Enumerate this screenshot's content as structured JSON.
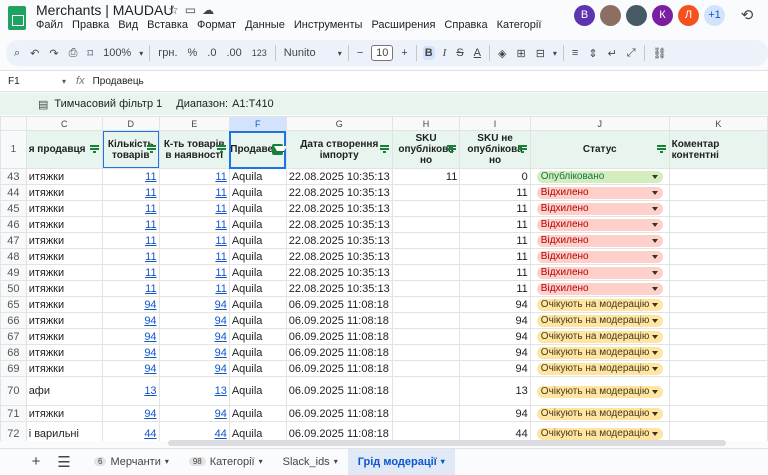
{
  "app": {
    "title": "Merchants | MAUDAU",
    "menu": [
      "Файл",
      "Правка",
      "Вид",
      "Вставка",
      "Формат",
      "Данные",
      "Инструменты",
      "Расширения",
      "Справка",
      "Категорії"
    ],
    "avatars": [
      {
        "letter": "В",
        "color": "#5e35b1"
      },
      {
        "letter": "",
        "color": "#8d6e63"
      },
      {
        "letter": "",
        "color": "#455a64"
      },
      {
        "letter": "К",
        "color": "#7b1fa2"
      },
      {
        "letter": "Л",
        "color": "#f4511e"
      },
      {
        "letter": "+1",
        "color": "#d3e3fd"
      }
    ]
  },
  "toolbar": {
    "zoom": "100%",
    "currency": "грн.",
    "percent": "%",
    "dec_less": ".0",
    "dec_more": ".00",
    "format_123": "123",
    "font": "Nunito",
    "font_size": "10"
  },
  "formula": {
    "cell": "F1",
    "content": "Продавець"
  },
  "filter_info": {
    "name": "Тимчасовий фільтр 1",
    "range_label": "Диапазон:",
    "range": "A1:T410"
  },
  "columns": [
    "C",
    "D",
    "E",
    "F",
    "G",
    "H",
    "I",
    "J",
    "K"
  ],
  "header": {
    "row_num": "1",
    "c": "я продавця",
    "d": "Кількість товарів",
    "e": "К-ть товарів в наявності",
    "f": "Продавець",
    "g": "Дата створення імпорту",
    "h": "SKU опублікова но",
    "i": "SKU не опублікова но",
    "j": "Статус",
    "k": "Коментар контентні"
  },
  "rows": [
    {
      "n": "43",
      "c": "итяжки",
      "d": "11",
      "e": "11",
      "f": "Aquila",
      "g": "22.08.2025 10:35:13",
      "h": "11",
      "i": "0",
      "status": "Опубліковано",
      "type": "pub"
    },
    {
      "n": "44",
      "c": "итяжки",
      "d": "11",
      "e": "11",
      "f": "Aquila",
      "g": "22.08.2025 10:35:13",
      "h": "",
      "i": "11",
      "status": "Відхилено",
      "type": "rej"
    },
    {
      "n": "45",
      "c": "итяжки",
      "d": "11",
      "e": "11",
      "f": "Aquila",
      "g": "22.08.2025 10:35:13",
      "h": "",
      "i": "11",
      "status": "Відхилено",
      "type": "rej"
    },
    {
      "n": "46",
      "c": "итяжки",
      "d": "11",
      "e": "11",
      "f": "Aquila",
      "g": "22.08.2025 10:35:13",
      "h": "",
      "i": "11",
      "status": "Відхилено",
      "type": "rej"
    },
    {
      "n": "47",
      "c": "итяжки",
      "d": "11",
      "e": "11",
      "f": "Aquila",
      "g": "22.08.2025 10:35:13",
      "h": "",
      "i": "11",
      "status": "Відхилено",
      "type": "rej"
    },
    {
      "n": "48",
      "c": "итяжки",
      "d": "11",
      "e": "11",
      "f": "Aquila",
      "g": "22.08.2025 10:35:13",
      "h": "",
      "i": "11",
      "status": "Відхилено",
      "type": "rej"
    },
    {
      "n": "49",
      "c": "итяжки",
      "d": "11",
      "e": "11",
      "f": "Aquila",
      "g": "22.08.2025 10:35:13",
      "h": "",
      "i": "11",
      "status": "Відхилено",
      "type": "rej"
    },
    {
      "n": "50",
      "c": "итяжки",
      "d": "11",
      "e": "11",
      "f": "Aquila",
      "g": "22.08.2025 10:35:13",
      "h": "",
      "i": "11",
      "status": "Відхилено",
      "type": "rej"
    },
    {
      "n": "65",
      "c": "итяжки",
      "d": "94",
      "e": "94",
      "f": "Aquila",
      "g": "06.09.2025 11:08:18",
      "h": "",
      "i": "94",
      "status": "Очікують на модерацію",
      "type": "mod"
    },
    {
      "n": "66",
      "c": "итяжки",
      "d": "94",
      "e": "94",
      "f": "Aquila",
      "g": "06.09.2025 11:08:18",
      "h": "",
      "i": "94",
      "status": "Очікують на модерацію",
      "type": "mod"
    },
    {
      "n": "67",
      "c": "итяжки",
      "d": "94",
      "e": "94",
      "f": "Aquila",
      "g": "06.09.2025 11:08:18",
      "h": "",
      "i": "94",
      "status": "Очікують на модерацію",
      "type": "mod"
    },
    {
      "n": "68",
      "c": "итяжки",
      "d": "94",
      "e": "94",
      "f": "Aquila",
      "g": "06.09.2025 11:08:18",
      "h": "",
      "i": "94",
      "status": "Очікують на модерацію",
      "type": "mod"
    },
    {
      "n": "69",
      "c": "итяжки",
      "d": "94",
      "e": "94",
      "f": "Aquila",
      "g": "06.09.2025 11:08:18",
      "h": "",
      "i": "94",
      "status": "Очікують на модерацію",
      "type": "mod"
    },
    {
      "n": "70",
      "c": "афи",
      "d": "13",
      "e": "13",
      "f": "Aquila",
      "g": "06.09.2025 11:08:18",
      "h": "",
      "i": "13",
      "status": "Очікують на модерацію",
      "type": "mod",
      "tall": true
    },
    {
      "n": "71",
      "c": "итяжки",
      "d": "94",
      "e": "94",
      "f": "Aquila",
      "g": "06.09.2025 11:08:18",
      "h": "",
      "i": "94",
      "status": "Очікують на модерацію",
      "type": "mod"
    },
    {
      "n": "72",
      "c": "і варильні",
      "d": "44",
      "e": "44",
      "f": "Aquila",
      "g": "06.09.2025 11:08:18",
      "h": "",
      "i": "44",
      "status": "Очікують на модерацію",
      "type": "mod",
      "tall2": true
    }
  ],
  "status_colors": {
    "pub": {
      "bg": "#d4edbc",
      "fg": "#11734b"
    },
    "rej": {
      "bg": "#ffcfc9",
      "fg": "#b10202"
    },
    "mod": {
      "bg": "#ffe5a0",
      "fg": "#473821"
    }
  },
  "sheets": [
    {
      "label": "Мерчанти",
      "badge": "6",
      "active": false
    },
    {
      "label": "Категорії",
      "badge": "98",
      "active": false
    },
    {
      "label": "Slack_ids",
      "badge": "",
      "active": false
    },
    {
      "label": "Грід модерації",
      "badge": "",
      "active": true
    }
  ]
}
